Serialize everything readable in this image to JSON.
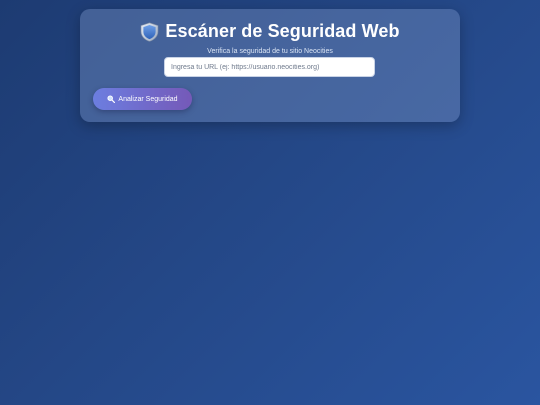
{
  "header": {
    "icon": "shield-icon",
    "title": "Escáner de Seguridad Web",
    "subtitle": "Verifica la seguridad de tu sitio Neocities"
  },
  "form": {
    "url_value": "",
    "url_placeholder": "Ingresa tu URL (ej: https://usuario.neocities.org)",
    "scan_button_icon": "magnifier-icon",
    "scan_button_label": "Analizar Seguridad"
  },
  "colors": {
    "background_start": "#1d3b72",
    "background_end": "#2a55a0",
    "button_start": "#6c7ee0",
    "button_end": "#7559b8",
    "title_text": "#ffffff"
  }
}
